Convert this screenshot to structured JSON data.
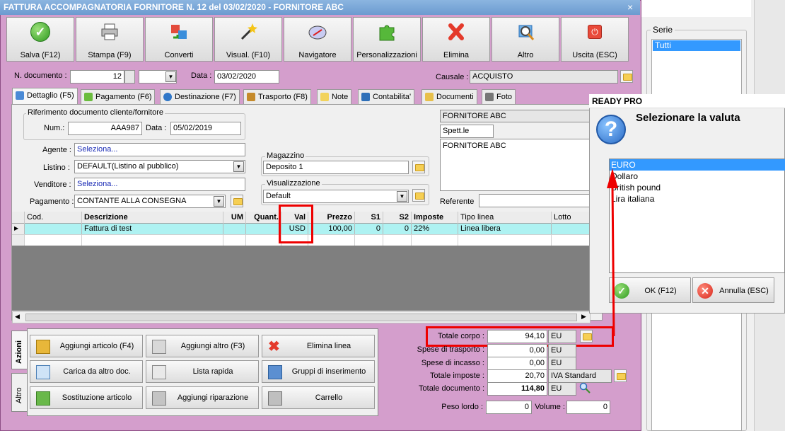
{
  "window": {
    "title": "FATTURA ACCOMPAGNATORIA FORNITORE N. 12 del 03/02/2020 - FORNITORE ABC",
    "close": "×"
  },
  "toolbar": [
    {
      "label": "Salva (F12)",
      "icon": "save-check-icon"
    },
    {
      "label": "Stampa (F9)",
      "icon": "printer-icon"
    },
    {
      "label": "Converti",
      "icon": "convert-icon"
    },
    {
      "label": "Visual. (F10)",
      "icon": "magic-wand-icon"
    },
    {
      "label": "Navigatore",
      "icon": "compass-icon"
    },
    {
      "label": "Personalizzazioni",
      "icon": "puzzle-icon"
    },
    {
      "label": "Elimina",
      "icon": "delete-x-icon"
    },
    {
      "label": "Altro",
      "icon": "magnifier-icon"
    },
    {
      "label": "Uscita (ESC)",
      "icon": "exit-icon"
    }
  ],
  "header": {
    "ndoc_label": "N. documento :",
    "ndoc_value": "12",
    "data_label": "Data :",
    "data_value": "03/02/2020",
    "causale_label": "Causale :",
    "causale_value": "ACQUISTO"
  },
  "tabs": [
    {
      "label": "Dettaglio (F5)",
      "color": "#4a8ad6"
    },
    {
      "label": "Pagamento (F6)",
      "color": "#6bbd3e"
    },
    {
      "label": "Destinazione (F7)",
      "color": "#2f77c8"
    },
    {
      "label": "Trasporto (F8)",
      "color": "#c58a2b"
    },
    {
      "label": "Note",
      "color": "#f2d35c"
    },
    {
      "label": "Contabilita'",
      "color": "#2e6fb8"
    },
    {
      "label": "Documenti",
      "color": "#e8c04a"
    },
    {
      "label": "Foto",
      "color": "#777777"
    }
  ],
  "dettaglio": {
    "rif_title": "Riferimento documento cliente/fornitore",
    "num_label": "Num.:",
    "num_value": "AAA987",
    "data_label": "Data :",
    "data_value": "05/02/2019",
    "agente_label": "Agente :",
    "agente_value": "Seleziona...",
    "listino_label": "Listino :",
    "listino_value": "DEFAULT(Listino al pubblico)",
    "venditore_label": "Venditore :",
    "venditore_value": "Seleziona...",
    "pagamento_label": "Pagamento :",
    "pagamento_value": "CONTANTE ALLA CONSEGNA",
    "magazzino_title": "Magazzino",
    "magazzino_value": "Deposito 1",
    "visualizzazione_title": "Visualizzazione",
    "visualizzazione_value": "Default",
    "fornitore_name": "FORNITORE ABC",
    "spett": "Spett.le",
    "address": "FORNITORE ABC",
    "referente_label": "Referente"
  },
  "grid": {
    "columns": [
      "Cod.",
      "Descrizione",
      "UM",
      "Quant.",
      "Val",
      "Prezzo",
      "S1",
      "S2",
      "Imposte",
      "Tipo linea",
      "Lotto"
    ],
    "rows": [
      {
        "cod": "",
        "descrizione": "Fattura di test",
        "um": "",
        "quant": "",
        "val": "USD",
        "prezzo": "100,00",
        "s1": "0",
        "s2": "0",
        "imposte": "22%",
        "tipo_linea": "Linea libera",
        "lotto": ""
      }
    ]
  },
  "vtabs": {
    "azioni": "Azioni",
    "altro": "Altro"
  },
  "actions": [
    {
      "label": "Aggiungi articolo (F4)",
      "icon": "add-item-icon"
    },
    {
      "label": "Aggiungi altro (F3)",
      "icon": "add-other-icon"
    },
    {
      "label": "Elimina linea",
      "icon": "delete-line-icon"
    },
    {
      "label": "Carica da altro doc.",
      "icon": "load-doc-icon"
    },
    {
      "label": "Lista rapida",
      "icon": "quick-list-icon"
    },
    {
      "label": "Gruppi di inserimento",
      "icon": "groups-icon"
    },
    {
      "label": "Sostituzione articolo",
      "icon": "replace-item-icon"
    },
    {
      "label": "Aggiungi riparazione",
      "icon": "wrench-icon"
    },
    {
      "label": "Carrello",
      "icon": "cart-icon"
    }
  ],
  "totals": {
    "totale_corpo_label": "Totale corpo :",
    "totale_corpo_value": "94,10",
    "totale_corpo_cur": "EU",
    "spese_trasporto_label": "Spese di trasporto :",
    "spese_trasporto_value": "0,00",
    "spese_trasporto_cur": "EU",
    "spese_incasso_label": "Spese di incasso :",
    "spese_incasso_value": "0,00",
    "spese_incasso_cur": "EU",
    "totale_imposte_label": "Totale imposte :",
    "totale_imposte_value": "20,70",
    "totale_imposte_desc": "IVA Standard",
    "totale_documento_label": "Totale documento :",
    "totale_documento_value": "114,80",
    "totale_documento_cur": "EU",
    "peso_label": "Peso lordo :",
    "peso_value": "0",
    "volume_label": "Volume :",
    "volume_value": "0"
  },
  "serie": {
    "title": "Serie",
    "items": [
      "Tutti"
    ]
  },
  "dialog": {
    "title": "READY PRO",
    "message": "Selezionare la valuta",
    "options": [
      "EURO",
      "Dollaro",
      "British pound",
      "Lira italiana"
    ],
    "selected": "EURO",
    "ok_label": "OK (F12)",
    "cancel_label": "Annulla (ESC)"
  },
  "colors": {
    "window_bg": "#d49ecc",
    "titlebar": "#7ba7d8",
    "highlight": "#e00000",
    "selection": "#3399ff",
    "grid_row": "#aef2f2"
  }
}
